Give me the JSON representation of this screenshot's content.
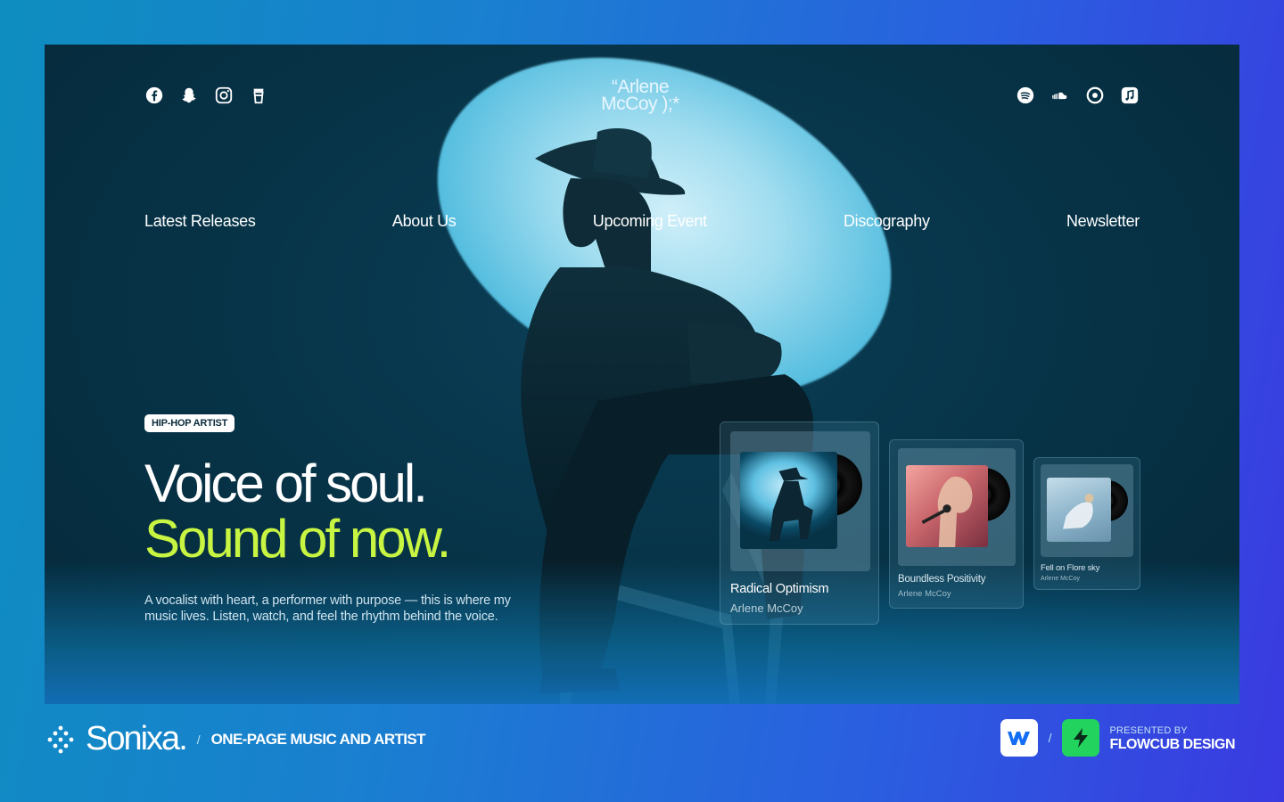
{
  "site": {
    "logo_line1": "“Arlene",
    "logo_line2": "McCoy );*"
  },
  "social_left": [
    {
      "icon": "facebook-icon"
    },
    {
      "icon": "snapchat-icon"
    },
    {
      "icon": "instagram-icon"
    },
    {
      "icon": "cup-icon"
    }
  ],
  "social_right": [
    {
      "icon": "spotify-icon"
    },
    {
      "icon": "soundcloud-icon"
    },
    {
      "icon": "play-circle-icon"
    },
    {
      "icon": "music-note-icon"
    }
  ],
  "nav": {
    "items": [
      "Latest Releases",
      "About Us",
      "Upcoming Event",
      "Discography",
      "Newsletter"
    ]
  },
  "hero": {
    "badge": "HIP-HOP ARTIST",
    "headline_line1": "Voice of soul.",
    "headline_line2": "Sound of now.",
    "description": "A vocalist with heart, a performer with purpose — this is where my music lives. Listen, watch, and feel the rhythm behind the voice.",
    "accent_color": "#c8f542"
  },
  "releases": [
    {
      "title": "Radical Optimism",
      "artist": "Arlene McCoy"
    },
    {
      "title": "Boundless Positivity",
      "artist": "Arlene McCoy"
    },
    {
      "title": "Fell on Flore sky",
      "artist": "Arlene McCoy"
    }
  ],
  "footer": {
    "brand": "Sonixa.",
    "separator": "/",
    "tagline": "ONE-PAGE MUSIC AND ARTIST",
    "presented_by": "PRESENTED BY",
    "studio": "FLOWCUB DESIGN",
    "webflow_color": "#146ef5",
    "flowcub_color": "#22d35e"
  }
}
